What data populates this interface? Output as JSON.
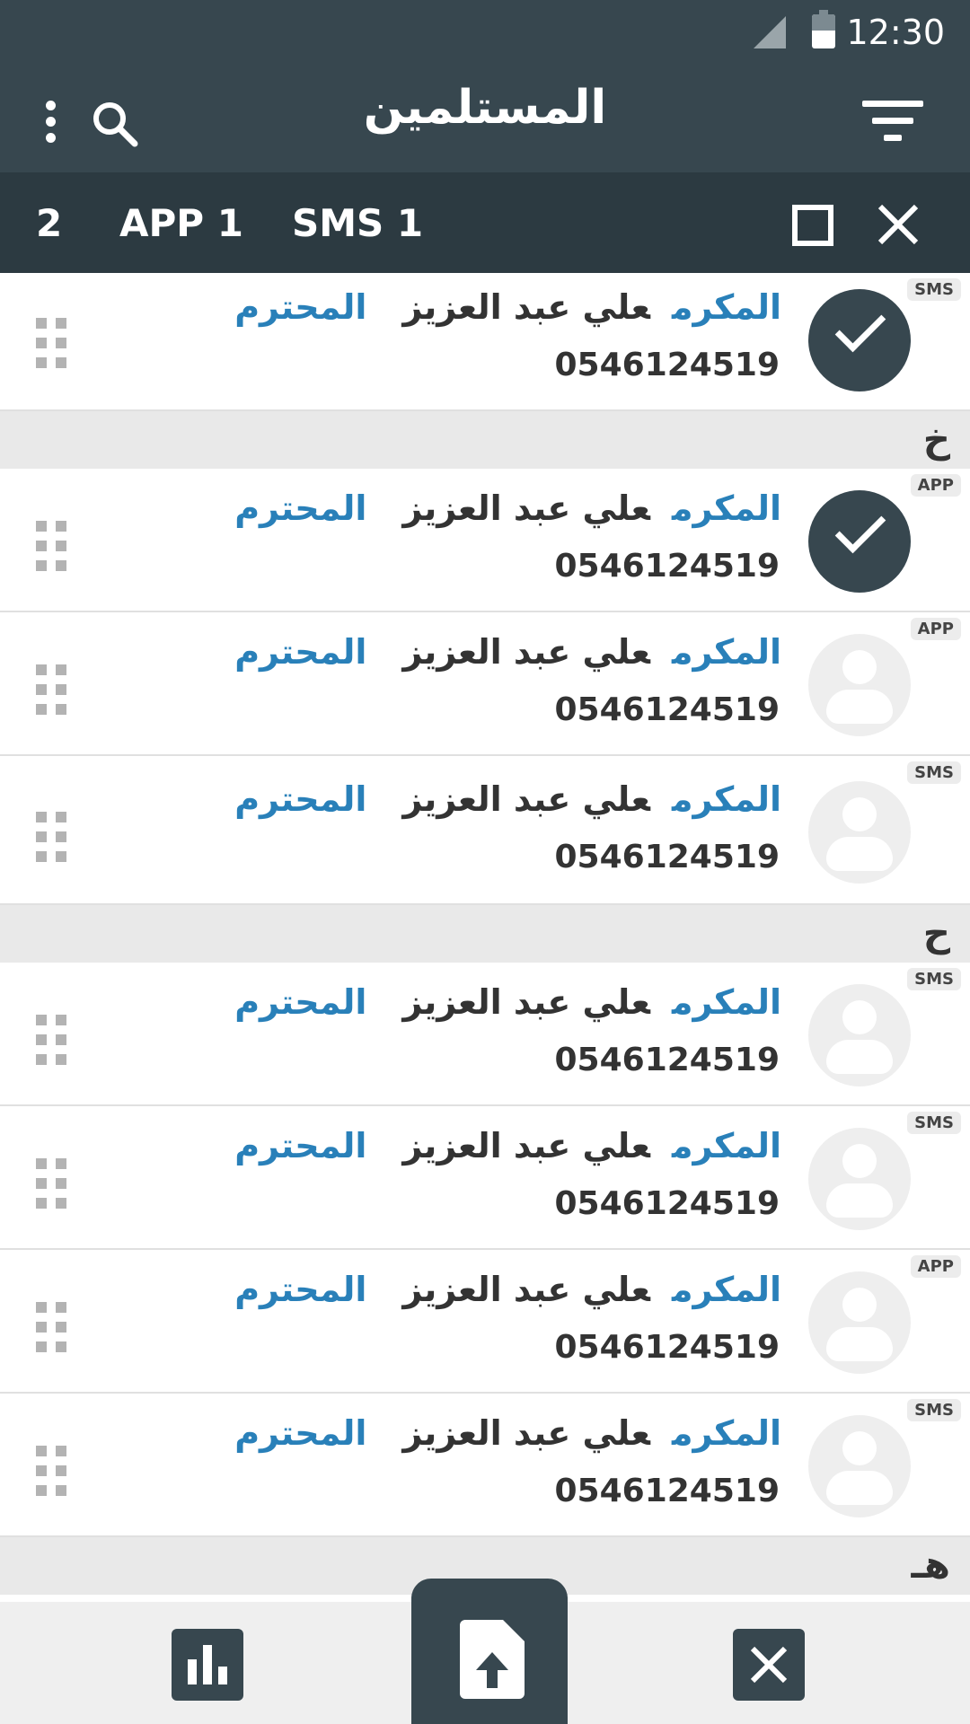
{
  "status_bar": {
    "time": "12:30"
  },
  "toolbar": {
    "title": "المستلمين"
  },
  "selection_bar": {
    "count": "2",
    "app_label": "APP 1",
    "sms_label": "SMS 1"
  },
  "sections": [
    "خ",
    "ح",
    "هـ"
  ],
  "rows": [
    {
      "badge": "SMS",
      "honor": "المكرم",
      "name": "علي عبد العزيز",
      "respected": "المحترم",
      "phone": "0546124519",
      "selected": true
    },
    {
      "badge": "APP",
      "honor": "المكرم",
      "name": "علي عبد العزيز",
      "respected": "المحترم",
      "phone": "0546124519",
      "selected": true
    },
    {
      "badge": "APP",
      "honor": "المكرم",
      "name": "علي عبد العزيز",
      "respected": "المحترم",
      "phone": "0546124519",
      "selected": false
    },
    {
      "badge": "SMS",
      "honor": "المكرم",
      "name": "علي عبد العزيز",
      "respected": "المحترم",
      "phone": "0546124519",
      "selected": false
    },
    {
      "badge": "SMS",
      "honor": "المكرم",
      "name": "علي عبد العزيز",
      "respected": "المحترم",
      "phone": "0546124519",
      "selected": false
    },
    {
      "badge": "SMS",
      "honor": "المكرم",
      "name": "علي عبد العزيز",
      "respected": "المحترم",
      "phone": "0546124519",
      "selected": false
    },
    {
      "badge": "APP",
      "honor": "المكرم",
      "name": "علي عبد العزيز",
      "respected": "المحترم",
      "phone": "0546124519",
      "selected": false
    },
    {
      "badge": "SMS",
      "honor": "المكرم",
      "name": "علي عبد العزيز",
      "respected": "المحترم",
      "phone": "0546124519",
      "selected": false
    }
  ],
  "colors": {
    "primary": "#37474f",
    "accent": "#2980b9",
    "section_bg": "#e9e9e9"
  },
  "icons": {
    "toolbar": [
      "more-vert-icon",
      "search-icon",
      "filter-icon"
    ],
    "selection": [
      "select-all-icon",
      "close-icon"
    ],
    "bottom": [
      "bar-chart-icon",
      "upload-file-icon",
      "cancel-icon"
    ],
    "row": [
      "check-icon",
      "person-icon",
      "drag-handle-icon"
    ]
  }
}
